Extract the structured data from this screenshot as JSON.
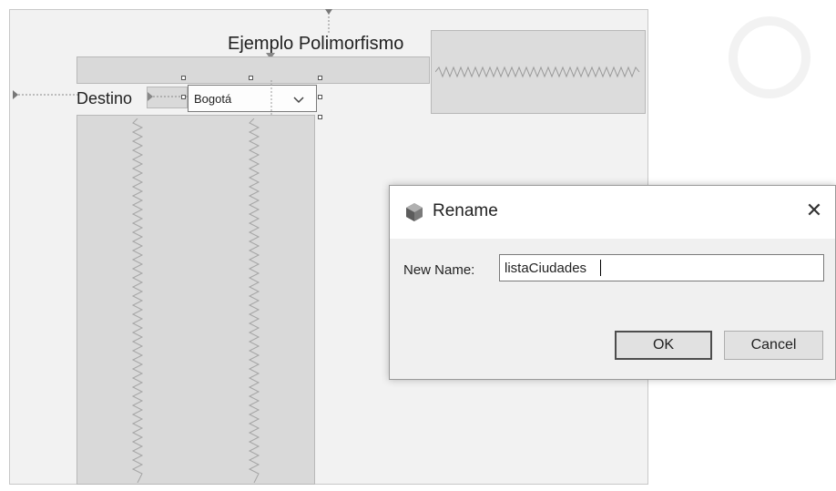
{
  "form": {
    "title_label": "Ejemplo Polimorfismo",
    "destino_label": "Destino",
    "combo_value": "Bogotá"
  },
  "dialog": {
    "title": "Rename",
    "new_name_label": "New Name:",
    "new_name_value": "listaCiudades",
    "ok_label": "OK",
    "cancel_label": "Cancel",
    "close_glyph": "✕"
  },
  "icons": {
    "dialog_icon": "netbeans-cube-icon",
    "combo_arrow": "chevron-down-icon",
    "close": "close-icon"
  }
}
